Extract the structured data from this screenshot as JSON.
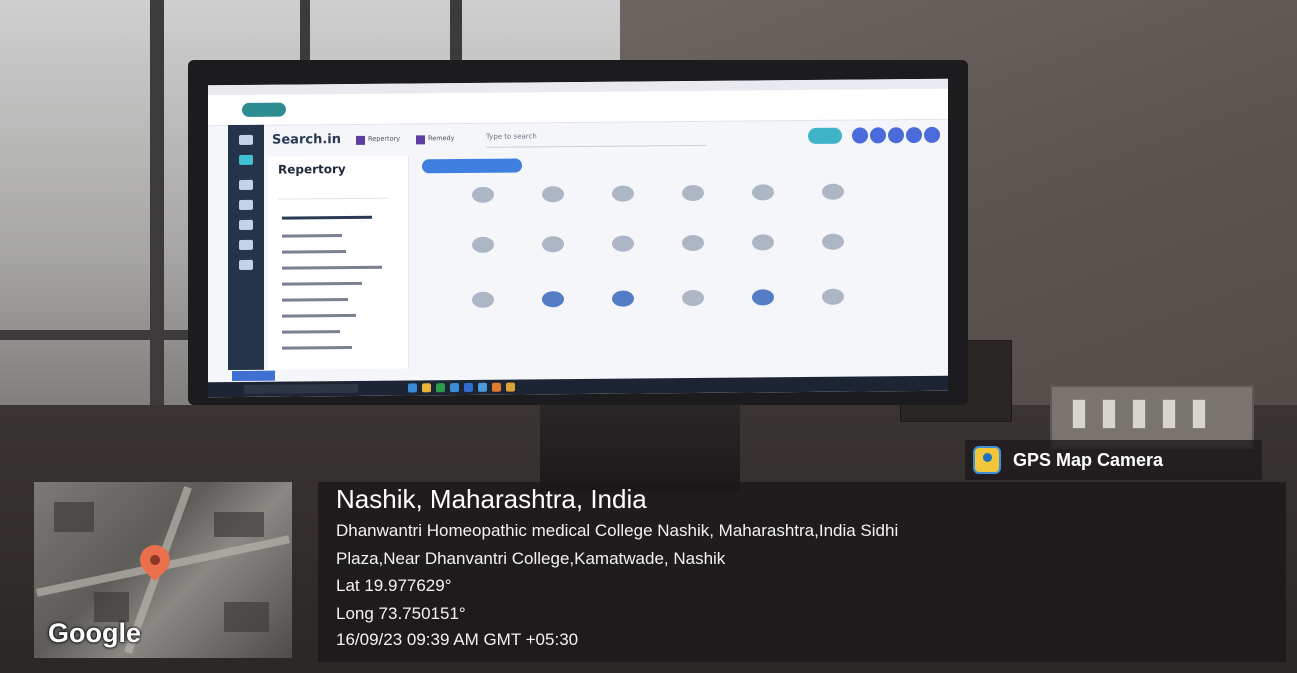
{
  "monitor_screen": {
    "search_title": "Search.in",
    "search_placeholder": "Type to search",
    "checkbox_1": "Repertory",
    "checkbox_2": "Remedy",
    "panel_title": "Repertory"
  },
  "gps_overlay": {
    "app_name": "GPS Map Camera",
    "location_title": "Nashik, Maharashtra, India",
    "address_line_1": "Dhanwantri Homeopathic medical College Nashik, Maharashtra,India Sidhi",
    "address_line_2": "Plaza,Near Dhanvantri College,Kamatwade, Nashik",
    "latitude": "Lat 19.977629°",
    "longitude": "Long 73.750151°",
    "timestamp": "16/09/23 09:39 AM GMT +05:30",
    "map_brand": "Google"
  },
  "colors": {
    "overlay_bg": "#1c181a",
    "pin": "#ea6f4c",
    "gps_logo": "#f2c63a",
    "screen_sidebar": "#25344a",
    "accent": "#3fb3c8"
  }
}
